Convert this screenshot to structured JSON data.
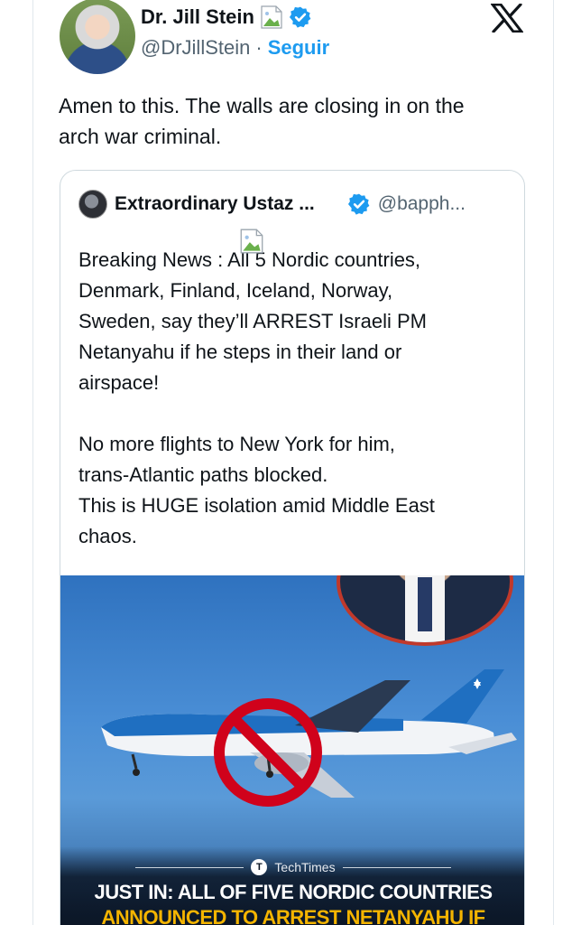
{
  "tweet": {
    "author_name": "Dr. Jill Stein",
    "author_handle": "@DrJillStein",
    "separator": "·",
    "follow_label": "Seguir",
    "text_line1": "Amen to this. The walls are closing in on the",
    "text_line2": "arch war criminal."
  },
  "quote": {
    "author_name": "Extraordinary Ustaz ...",
    "author_handle": "@bapph...",
    "lines": [
      "Breaking News : All 5 Nordic countries,",
      "Denmark, Finland, Iceland, Norway,",
      "Sweden, say they’ll ARREST Israeli PM",
      "Netanyahu if he steps in their land or",
      "airspace!",
      "",
      "No more flights to New York for him,",
      "trans-Atlantic paths blocked.",
      "This is HUGE isolation amid Middle East",
      "chaos."
    ]
  },
  "media": {
    "source_logo": "T",
    "source_name": "TechTimes",
    "headline_line1": "JUST IN: ALL OF FIVE NORDIC COUNTRIES",
    "headline_line2": "ANNOUNCED TO ARREST NETANYAHU IF"
  },
  "icons": {
    "verified": "verified-badge-icon",
    "x_logo": "x-logo-icon",
    "broken_image": "broken-image-icon"
  },
  "colors": {
    "accent": "#1d9bf0",
    "text": "#0f1419",
    "muted": "#536471",
    "headline_yellow": "#f4b400",
    "no_sign": "#d0021b"
  }
}
